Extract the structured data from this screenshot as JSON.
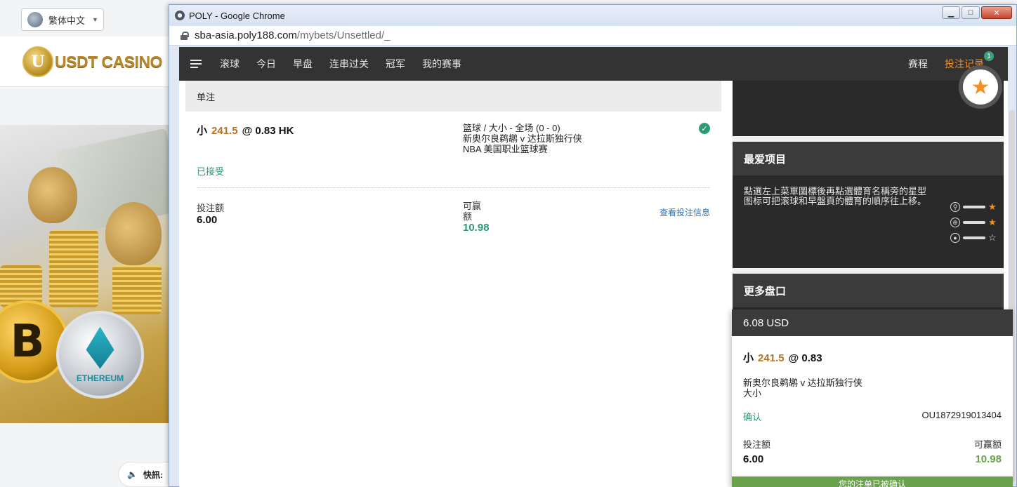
{
  "background": {
    "language": "繁体中文",
    "logo_text": "USDT CASINO",
    "logo_letter": "U",
    "eth_label": "ETHEREUM",
    "btc_symbol": "B",
    "news_label": "快訊:"
  },
  "window": {
    "title": "POLY - Google Chrome",
    "url_host": "sba-asia.poly188.com",
    "url_path": "/mybets/Unsettled/_"
  },
  "nav": {
    "items": [
      "滚球",
      "今日",
      "早盘",
      "连串过关",
      "冠军",
      "我的赛事"
    ],
    "right": {
      "schedule": "赛程",
      "records": "投注记录",
      "badge": "1"
    }
  },
  "bet": {
    "section": "单注",
    "selection": "小",
    "line": "241.5",
    "at": "@",
    "odds": "0.83 HK",
    "market": "篮球 / 大小 - 全场 (0 - 0)",
    "match": "新奥尔良鹈鹕 v 达拉斯独行侠",
    "league": "NBA 美国职业篮球赛",
    "status": "已接受",
    "stake_label": "投注额",
    "stake": "6.00",
    "win_label": "可赢额",
    "win": "10.98",
    "view_info": "查看投注信息"
  },
  "sidebar": {
    "fav_title": "最爱项目",
    "fav_text": "點選左上菜單圖標後再點選體育名稱旁的星型图标可把滚球和早盤頁的體育的順序往上移。",
    "more_title": "更多盘口"
  },
  "ticket": {
    "balance": "6.08 USD",
    "selection": "小",
    "line": "241.5",
    "at": "@",
    "odds": "0.83",
    "match": "新奥尔良鹈鹕 v 达拉斯独行侠",
    "market": "大小",
    "confirm": "确认",
    "ticket_id": "OU1872919013404",
    "stake_label": "投注额",
    "stake": "6.00",
    "win_label": "可赢额",
    "win": "10.98",
    "footer": "您的注单已被确认"
  }
}
